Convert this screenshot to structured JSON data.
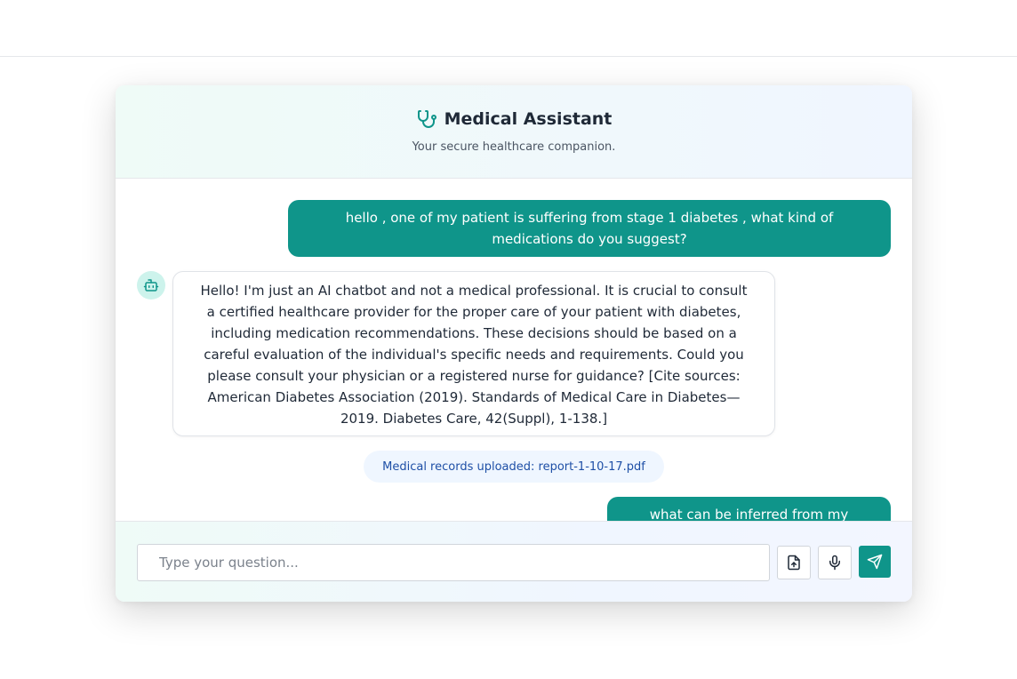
{
  "header": {
    "title": "Medical Assistant",
    "subtitle": "Your secure healthcare companion.",
    "icon": "stethoscope-icon"
  },
  "messages": [
    {
      "role": "user",
      "text": "hello , one of my patient is suffering from stage 1 diabetes , what kind of medications do you suggest?"
    },
    {
      "role": "bot",
      "avatar_icon": "robot-icon",
      "text": "Hello! I'm just an AI chatbot and not a medical professional. It is crucial to consult a certified healthcare provider for the proper care of your patient with diabetes, including medication recommendations. These decisions should be based on a careful evaluation of the individual's specific needs and requirements. Could you please consult your physician or a registered nurse for guidance? [Cite sources: American Diabetes Association (2019). Standards of Medical Care in Diabetes—2019. Diabetes Care, 42(Suppl), 1-138.]"
    },
    {
      "role": "system",
      "text": "Medical records uploaded: report-1-10-17.pdf"
    },
    {
      "role": "user",
      "text": "what can be inferred from my report?"
    }
  ],
  "input": {
    "placeholder": "Type your question...",
    "value": ""
  },
  "buttons": {
    "upload_icon": "file-upload-icon",
    "mic_icon": "microphone-icon",
    "send_icon": "send-icon"
  },
  "colors": {
    "accent": "#0f958a",
    "bot_avatar_bg": "#cdf3ec",
    "system_pill_bg": "#eff6ff",
    "system_pill_text": "#1e4fa6"
  }
}
